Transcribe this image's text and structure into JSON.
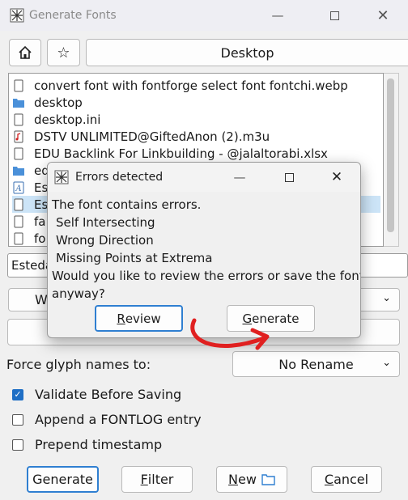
{
  "window": {
    "title": "Generate Fonts"
  },
  "toolbar": {
    "location_label": "Desktop"
  },
  "files": [
    {
      "name": "convert font with fontforge select font fontchi.webp",
      "icon": "file-icon"
    },
    {
      "name": "desktop",
      "icon": "folder-icon"
    },
    {
      "name": "desktop.ini",
      "icon": "file-icon"
    },
    {
      "name": "DSTV UNLIMITED@GiftedAnon (2).m3u",
      "icon": "music-file-icon"
    },
    {
      "name": "EDU Backlink For Linkbuilding - @jalaltorabi.xlsx",
      "icon": "file-icon"
    },
    {
      "name": "ed",
      "icon": "folder-icon"
    },
    {
      "name": "Es",
      "icon": "font-file-icon"
    },
    {
      "name": "Es",
      "icon": "file-icon",
      "selected": true
    },
    {
      "name": "fa",
      "icon": "file-icon"
    },
    {
      "name": "fo",
      "icon": "file-icon"
    }
  ],
  "filename_value": "Esteda",
  "format_row_label": "W",
  "force_glyph": {
    "label": "Force glyph names to:",
    "value": "No Rename"
  },
  "options": [
    {
      "label": "Validate Before Saving",
      "checked": true
    },
    {
      "label": "Append a FONTLOG entry",
      "checked": false
    },
    {
      "label": "Prepend timestamp",
      "checked": false
    }
  ],
  "buttons": {
    "generate": {
      "pre": "",
      "key": "G",
      "post": "enerate"
    },
    "filter": {
      "pre": "",
      "key": "F",
      "post": "ilter"
    },
    "new": {
      "pre": "",
      "key": "N",
      "post": "ew"
    },
    "cancel": {
      "pre": "",
      "key": "C",
      "post": "ancel"
    }
  },
  "dialog": {
    "title": "Errors detected",
    "line1": "The font contains errors.",
    "errors": [
      "Self Intersecting",
      "Wrong Direction",
      "Missing Points at Extrema"
    ],
    "question1": "Would you like to review the errors or save the font",
    "question2": "anyway?",
    "review": {
      "pre": "",
      "key": "R",
      "post": "eview"
    },
    "generate": {
      "pre": "",
      "key": "G",
      "post": "enerate"
    }
  },
  "colors": {
    "accent": "#2f7fd1",
    "annotation": "#e02020",
    "selection": "#cce4f7"
  }
}
